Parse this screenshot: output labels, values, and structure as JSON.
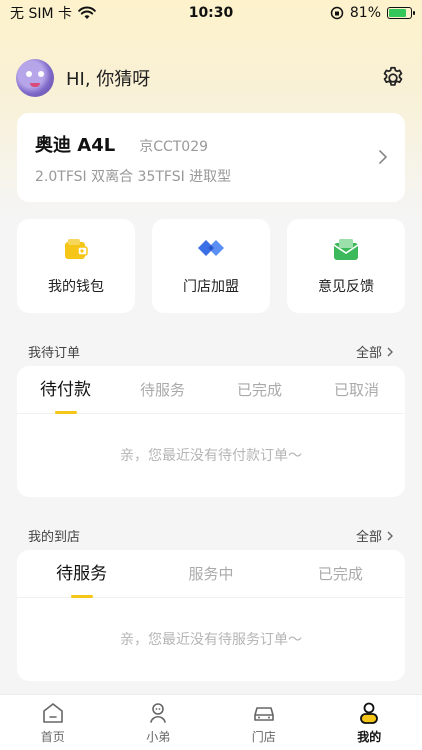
{
  "status": {
    "carrier": "无 SIM 卡",
    "time": "10:30",
    "battery": "81%",
    "battery_level": 0.81,
    "colors": {
      "battery": "#34c759"
    }
  },
  "header": {
    "greeting": "HI, 你猜呀",
    "settings_icon": "gear-icon"
  },
  "car": {
    "model": "奥迪 A4L",
    "plate": "京CCT029",
    "desc": "2.0TFSI 双离合 35TFSI 进取型"
  },
  "quick_actions": [
    {
      "label": "我的钱包",
      "icon": "wallet-icon",
      "color": "#f5c518"
    },
    {
      "label": "门店加盟",
      "icon": "store-join-icon",
      "color": "#3a6fe8"
    },
    {
      "label": "意见反馈",
      "icon": "feedback-icon",
      "color": "#3cb95a"
    }
  ],
  "orders": {
    "title": "我待订单",
    "all_label": "全部",
    "tabs": [
      "待付款",
      "待服务",
      "已完成",
      "已取消"
    ],
    "active_tab": 0,
    "empty_text": "亲，您最近没有待付款订单～"
  },
  "visits": {
    "title": "我的到店",
    "all_label": "全部",
    "tabs": [
      "待服务",
      "服务中",
      "已完成"
    ],
    "active_tab": 0,
    "empty_text": "亲，您最近没有待服务订单～"
  },
  "tabbar": {
    "items": [
      {
        "label": "首页",
        "icon": "home-icon"
      },
      {
        "label": "小弟",
        "icon": "assistant-icon"
      },
      {
        "label": "门店",
        "icon": "car-store-icon"
      },
      {
        "label": "我的",
        "icon": "profile-icon"
      }
    ],
    "active": 3,
    "accent": "#f5c518"
  }
}
